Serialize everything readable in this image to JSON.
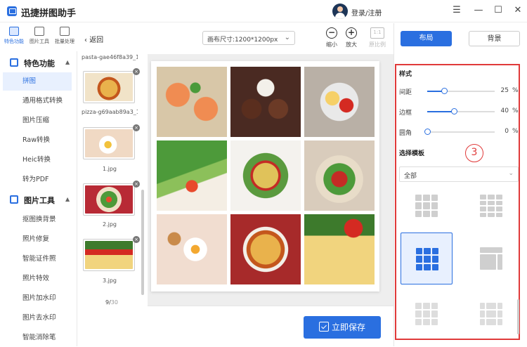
{
  "app": {
    "title": "迅捷拼图助手",
    "login": "登录/注册"
  },
  "window_controls": [
    "☰",
    "—",
    "☐",
    "✕"
  ],
  "top_tabs": [
    {
      "label": "特色功能",
      "icon": "star-grid-icon",
      "active": true
    },
    {
      "label": "图片工具",
      "icon": "image-tool-icon",
      "active": false
    },
    {
      "label": "批量处理",
      "icon": "batch-icon",
      "active": false
    }
  ],
  "sidebar": {
    "section1": {
      "title": "特色功能",
      "icon": "feature-icon"
    },
    "items1": [
      "拼图",
      "通用格式转换",
      "图片压缩",
      "Raw转换",
      "Heic转换",
      "转为PDF"
    ],
    "section2": {
      "title": "图片工具",
      "icon": "image-tools-icon"
    },
    "items2": [
      "抠图换背景",
      "照片修复",
      "智能证件照",
      "照片特效",
      "图片加水印",
      "图片去水印",
      "智能消除笔"
    ]
  },
  "thumbs": {
    "items": [
      {
        "name": "pasta-gae46f8a39_1..."
      },
      {
        "name": "pizza-g69aab89a3_1..."
      },
      {
        "name": "1.jpg"
      },
      {
        "name": "2.jpg"
      },
      {
        "name": "3.jpg"
      }
    ],
    "counter_current": "9/",
    "counter_total": "30"
  },
  "toolbar": {
    "back": "返回",
    "canvas_size": "画布尺寸:1200*1200px",
    "zoom_out": "缩小",
    "zoom_in": "放大",
    "original": "原比例",
    "ratio_label": "1:1",
    "save": "立即保存"
  },
  "right_panel": {
    "tab_layout": "布局",
    "tab_background": "背景",
    "style_title": "样式",
    "sliders": [
      {
        "label": "间距",
        "value": "25",
        "unit": "%",
        "level": 0.25
      },
      {
        "label": "边框",
        "value": "40",
        "unit": "%",
        "level": 0.4
      },
      {
        "label": "圆角",
        "value": "0",
        "unit": "%",
        "level": 0.0
      }
    ],
    "template_title": "选择模板",
    "annotation_number": "3",
    "filter_value": "全部",
    "templates": [
      "grid-3x3-rows",
      "grid-3x4",
      "grid-3x3-selected",
      "grid-stacked",
      "grid-3x3-light",
      "grid-frame"
    ]
  },
  "colors": {
    "accent": "#2a6fe0",
    "highlight": "#e03a3a"
  }
}
